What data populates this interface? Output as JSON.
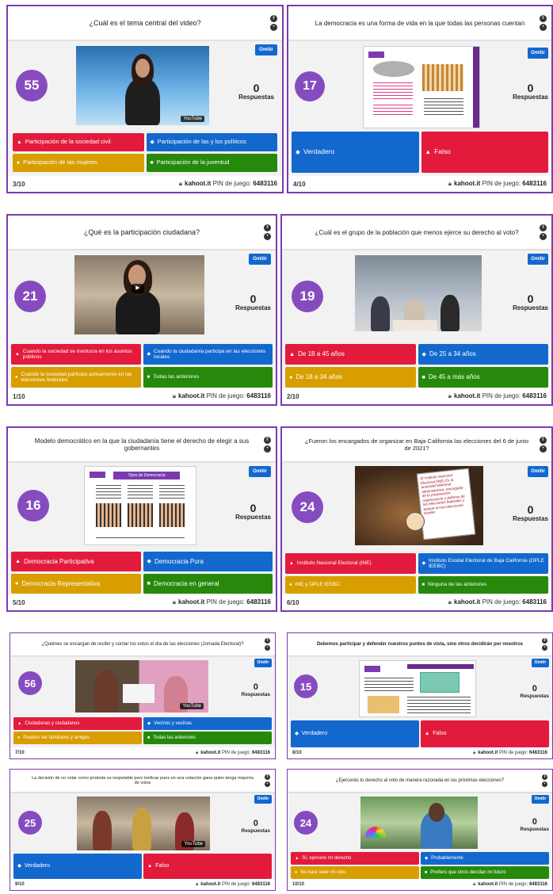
{
  "common": {
    "omit_label": "Omitir",
    "answers_label": "Respuestas",
    "answers_count": "0",
    "kahoot_site": "kahoot.it",
    "pin_label": "PIN de juego:",
    "pin_value": "6483116",
    "youtube_label": "YouTube"
  },
  "colors": {
    "red": "#e21b3c",
    "blue": "#1368ce",
    "gold": "#d89e00",
    "green": "#26890c",
    "purple": "#864cbf",
    "frame": "#7b3bb0"
  },
  "icons": {
    "triangle": "triangle-icon",
    "diamond": "diamond-icon",
    "circle": "circle-icon",
    "square": "square-icon"
  },
  "cards": [
    {
      "question": "¿Cuál es el tema central del video?",
      "timer": "55",
      "progress": "3/10",
      "answers": [
        "Participación de la sociedad civil",
        "Participación de las y los políticos",
        "Participación de las mujeres",
        "Participación de la juventud"
      ]
    },
    {
      "question": "La democracia es una forma de vida en la que todas las personas cuentan",
      "timer": "17",
      "progress": "4/10",
      "answers": [
        "Verdadero",
        "Falso"
      ]
    },
    {
      "question": "¿Qué es la participación ciudadana?",
      "timer": "21",
      "progress": "1/10",
      "answers": [
        "Cuando la sociedad se involucra en los asuntos públicos",
        "Cuando la ciudadanía participa en las elecciones locales",
        "Cuando la sociedad participa activamente en las elecciones federales",
        "Todas las anteriores"
      ]
    },
    {
      "question": "¿Cuál es el grupo de la población que menos ejerce su derecho al voto?",
      "timer": "19",
      "progress": "2/10",
      "answers": [
        "De 18 a 45 años",
        "De 25 a 34 años",
        "De 18 a 34 años",
        "De 45 a más años"
      ]
    },
    {
      "question": "Modelo democrático en la que la ciudadanía tiene el derecho de elegir a sus gobernantes",
      "timer": "16",
      "progress": "5/10",
      "slide_title": "Tipos de Democracia",
      "answers": [
        "Democracia Participativa",
        "Democracia Pura",
        "Democracia Representativa",
        "Democracia en general"
      ]
    },
    {
      "question": "¿Fueron los encargados de organizar en Baja California las elecciones del 6 de junio de 2021?",
      "timer": "24",
      "progress": "6/10",
      "board_text": "El Instituto Nacional Electoral (INE) Es la autoridad electoral administrativa, encargada de la preparación, organización y defensa de las elecciones federales y apoyar en las elecciones locales",
      "answers": [
        "Instituto Nacional Electoral (INE)",
        "Instituto Estatal Electoral de Baja California (OPLE IEEBC)",
        "INE y OPLE IEEBC",
        "Ninguna de las anteriores"
      ]
    },
    {
      "question": "¿Quiénes se encargan de recibir y contar los votos el día de las elecciones (Jornada Electoral)?",
      "timer": "56",
      "progress": "7/10",
      "answers": [
        "Ciudadanas y ciudadanos",
        "Vecinos y vecinas",
        "Pueden ser familiares y amigos",
        "Todas las anteriores"
      ]
    },
    {
      "question": "Debemos participar y defender nuestros puntos de vista, sino otros decidirán por nosotros",
      "timer": "15",
      "progress": "8/10",
      "answers": [
        "Verdadero",
        "Falso"
      ]
    },
    {
      "question": "La decisión de no votar como protesta es respetable pero ineficaz pues en una votación gana quien tenga mayoría de votos",
      "timer": "25",
      "progress": "9/10",
      "answers": [
        "Verdadero",
        "Falso"
      ]
    },
    {
      "question": "¿Ejercerás tu derecho al voto de manera razonada en las próximas elecciones?",
      "timer": "24",
      "progress": "10/10",
      "answers": [
        "Sí, ejerceré mi derecho",
        "Probablemente",
        "No haré valer mi voto",
        "Prefiero que otros decidan mi futuro"
      ]
    }
  ]
}
